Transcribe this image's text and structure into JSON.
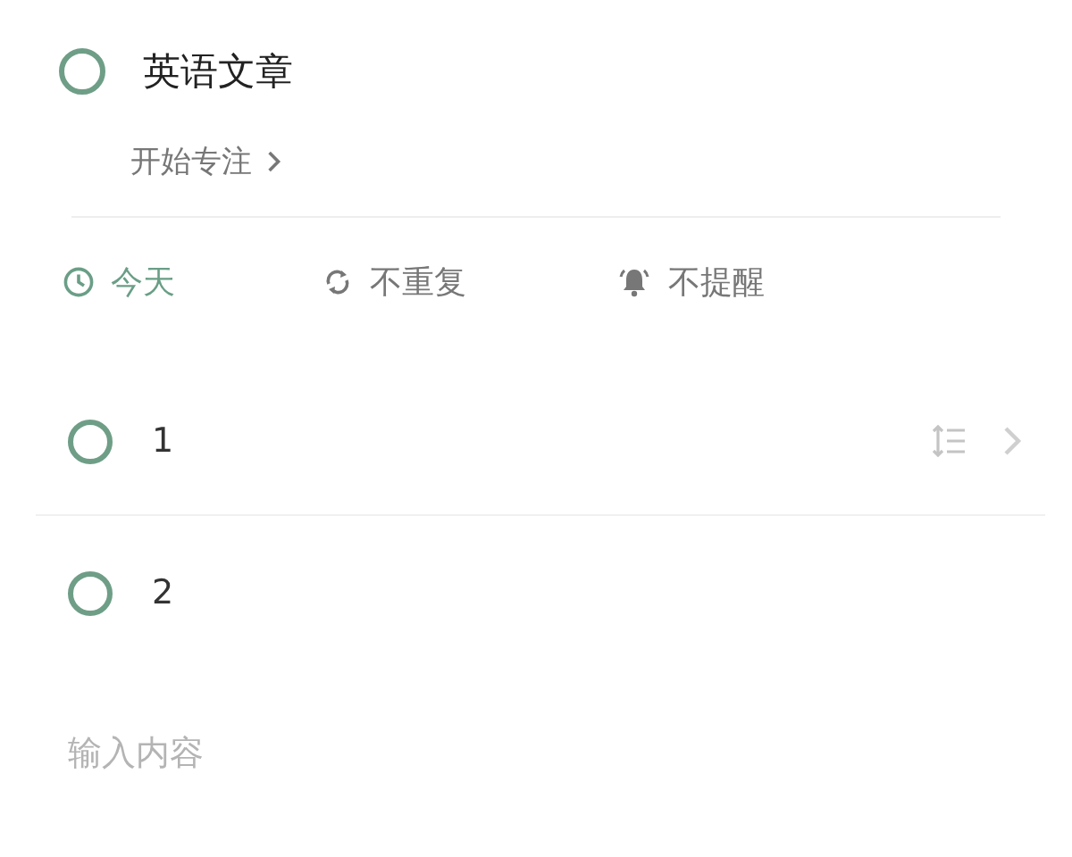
{
  "task": {
    "title": "英语文章",
    "checked": false,
    "focus_link": "开始专注"
  },
  "meta": [
    {
      "kind": "date",
      "label": "今天",
      "active": true
    },
    {
      "kind": "repeat",
      "label": "不重复",
      "active": false
    },
    {
      "kind": "reminder",
      "label": "不提醒",
      "active": false
    }
  ],
  "subtasks": [
    {
      "title": "1",
      "checked": false,
      "selected": true
    },
    {
      "title": "2",
      "checked": false,
      "selected": false
    }
  ],
  "input": {
    "placeholder": "输入内容"
  }
}
